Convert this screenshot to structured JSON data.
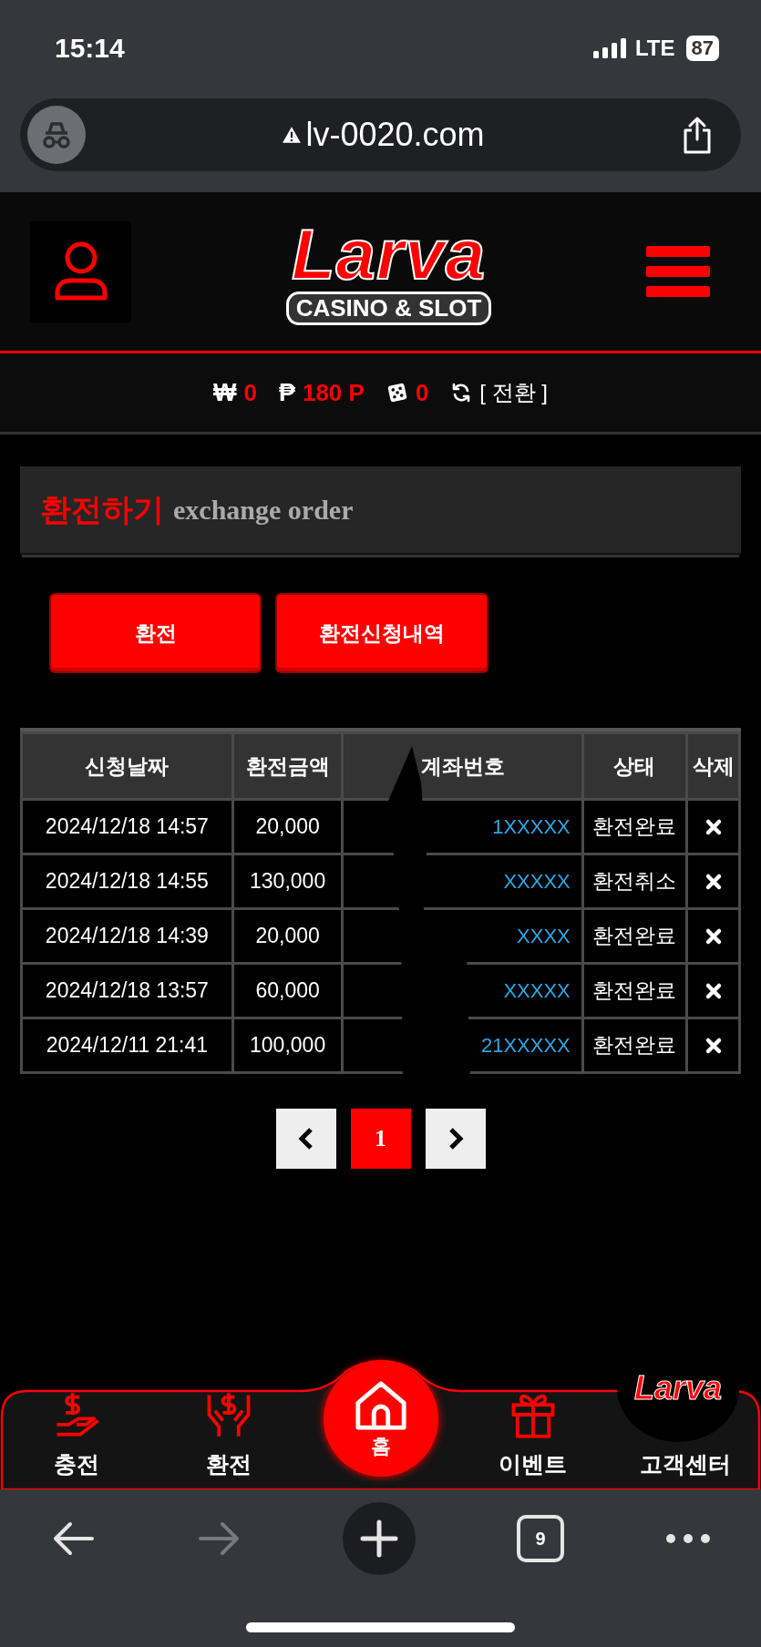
{
  "status_bar": {
    "time": "15:14",
    "network": "LTE",
    "battery": "87"
  },
  "browser": {
    "url": "lv-0020.com",
    "tab_count": "9"
  },
  "header": {
    "logo_title": "Larva",
    "logo_subtitle": "CASINO & SLOT"
  },
  "balance": {
    "items": [
      {
        "kind": "won",
        "symbol": "₩",
        "value": "0"
      },
      {
        "kind": "point",
        "symbol": "₱",
        "value": "180 P"
      },
      {
        "kind": "dice",
        "value": "0"
      }
    ],
    "switch_label": "[ 전환 ]"
  },
  "page_title": {
    "title": "환전하기",
    "subtitle": "exchange order"
  },
  "buttons": [
    "환전",
    "환전신청내역"
  ],
  "table": {
    "columns": [
      "신청날짜",
      "환전금액",
      "계좌번호",
      "상태",
      "삭제"
    ],
    "rows": [
      {
        "date": "2024/12/18 14:57",
        "amount": "20,000",
        "account": "1XXXXX",
        "status": "환전완료"
      },
      {
        "date": "2024/12/18 14:55",
        "amount": "130,000",
        "account": "XXXXX",
        "status": "환전취소"
      },
      {
        "date": "2024/12/18 14:39",
        "amount": "20,000",
        "account": "XXXX",
        "status": "환전완료"
      },
      {
        "date": "2024/12/18 13:57",
        "amount": "60,000",
        "account": "XXXXX",
        "status": "환전완료"
      },
      {
        "date": "2024/12/11 21:41",
        "amount": "100,000",
        "account": "21XXXXX",
        "status": "환전완료"
      }
    ]
  },
  "pagination": {
    "pages": [
      {
        "label": "1",
        "selected": true
      }
    ]
  },
  "bottom_nav": {
    "items": [
      {
        "kind": "charge",
        "label": "충전"
      },
      {
        "kind": "exchange",
        "label": "환전"
      },
      {
        "kind": "home",
        "label": "홈"
      },
      {
        "kind": "event",
        "label": "이벤트"
      },
      {
        "kind": "support",
        "label": "고객센터"
      }
    ],
    "badge_logo": "Larva"
  }
}
